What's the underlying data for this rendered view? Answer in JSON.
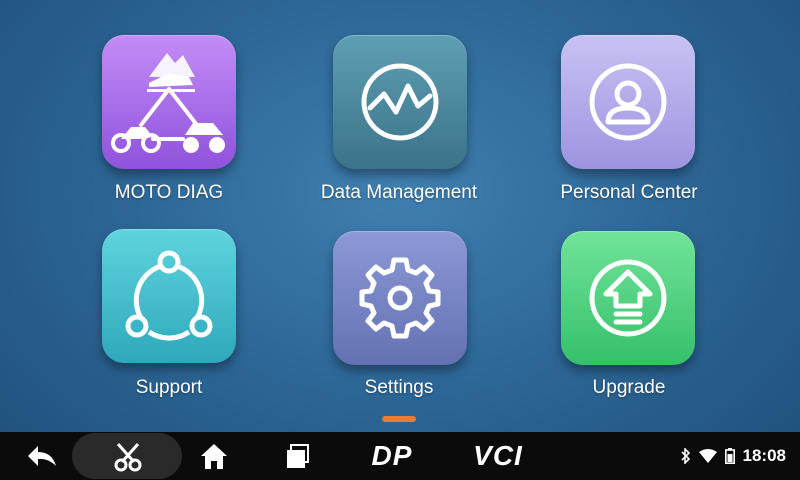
{
  "apps": [
    {
      "label": "MOTO DIAG",
      "icon": "moto-diag-icon",
      "color_top": "#c48cf7",
      "color_bottom": "#8f52dc"
    },
    {
      "label": "Data Management",
      "icon": "waveform-icon",
      "color_top": "#5f9fb3",
      "color_bottom": "#3b7389"
    },
    {
      "label": "Personal Center",
      "icon": "user-icon",
      "color_top": "#c8c2f3",
      "color_bottom": "#9d94e0"
    },
    {
      "label": "Support",
      "icon": "share-network-icon",
      "color_top": "#5fd4de",
      "color_bottom": "#2ea8bb"
    },
    {
      "label": "Settings",
      "icon": "gear-icon",
      "color_top": "#8d99d7",
      "color_bottom": "#6371b3"
    },
    {
      "label": "Upgrade",
      "icon": "upload-arrow-icon",
      "color_top": "#72e49a",
      "color_bottom": "#35c06a"
    }
  ],
  "navbar": {
    "buttons": [
      "back-icon",
      "scissors-icon",
      "home-icon",
      "recent-apps-icon",
      "dp-logo",
      "vci-logo"
    ],
    "dp_text": "DP",
    "vci_text": "VCI",
    "status_icons": [
      "bluetooth-icon",
      "wifi-icon",
      "battery-icon"
    ],
    "time": "18:08"
  },
  "accent": "#f07b2a"
}
